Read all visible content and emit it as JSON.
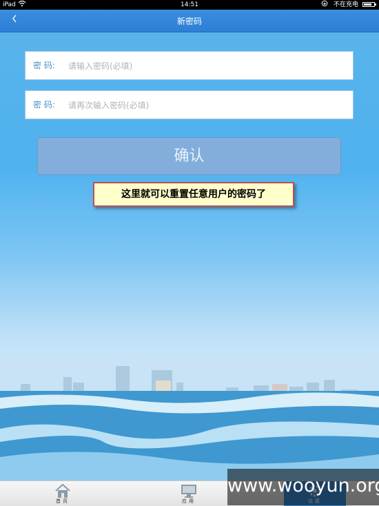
{
  "status_bar": {
    "carrier": "iPad",
    "time": "14:51",
    "charge_status": "不在充电"
  },
  "nav": {
    "back_icon": "chevron-left-icon",
    "title": "新密码"
  },
  "form": {
    "password": {
      "label": "密    码:",
      "placeholder": "请输入密码(必填)",
      "value": ""
    },
    "confirm_password": {
      "label": "密    码:",
      "placeholder": "请再次输入密码(必填)",
      "value": ""
    },
    "confirm_button": "确认"
  },
  "annotation": "这里就可以重置任意用户的密码了",
  "tabs": [
    {
      "label": "首页",
      "icon": "home-icon"
    },
    {
      "label": "应用",
      "icon": "monitor-icon"
    },
    {
      "label": "设置",
      "icon": "settings-icon",
      "active": true
    }
  ],
  "watermark": "www.wooyun.org",
  "colors": {
    "nav_bar": "#2c7fd6",
    "confirm_button": "#83aedc",
    "annotation_bg": "#ffffcc",
    "annotation_border": "#c0504d",
    "active_tab": "#3a8fd8"
  }
}
